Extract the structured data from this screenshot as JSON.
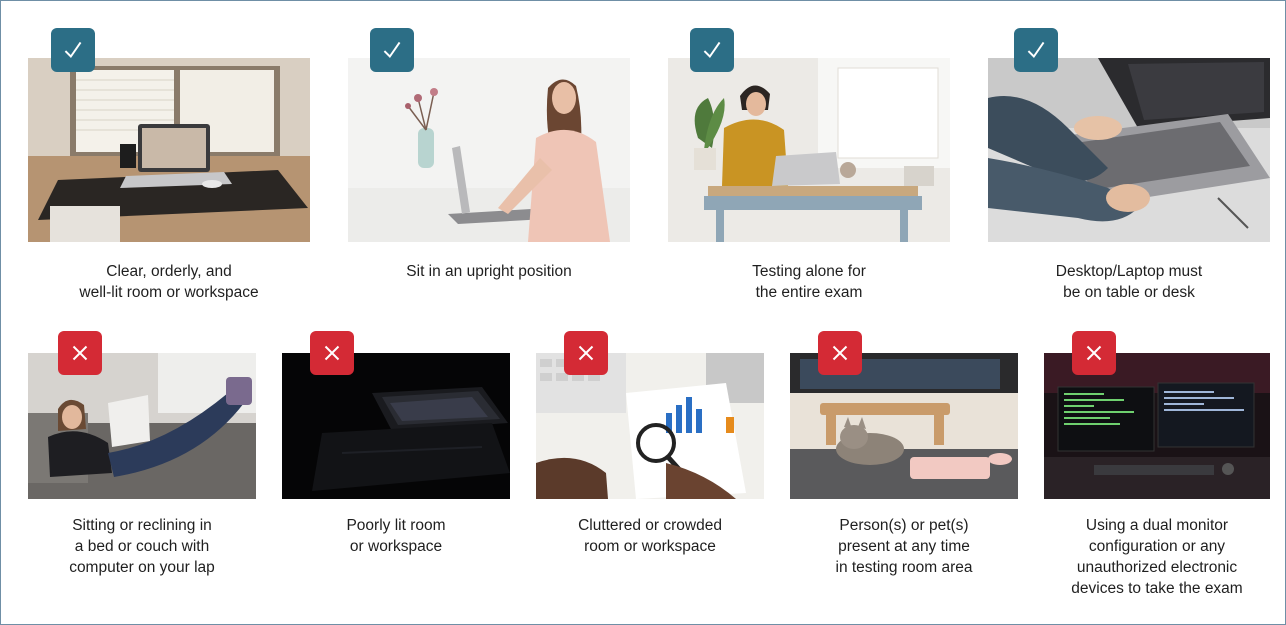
{
  "colors": {
    "frame_border": "#6f8fa6",
    "check_badge": "#2c6e86",
    "cross_badge": "#d42a35",
    "text": "#1f1f1f"
  },
  "dos": [
    {
      "icon": "checkmark-icon",
      "caption_lines": [
        "Clear, orderly, and",
        "well-lit room or workspace"
      ]
    },
    {
      "icon": "checkmark-icon",
      "caption_lines": [
        "Sit in an upright position"
      ]
    },
    {
      "icon": "checkmark-icon",
      "caption_lines": [
        "Testing alone for",
        "the entire exam"
      ]
    },
    {
      "icon": "checkmark-icon",
      "caption_lines": [
        "Desktop/Laptop must",
        "be on table or desk"
      ]
    }
  ],
  "donts": [
    {
      "icon": "cross-icon",
      "caption_lines": [
        "Sitting or reclining in",
        "a bed or couch with",
        "computer on your lap"
      ]
    },
    {
      "icon": "cross-icon",
      "caption_lines": [
        "Poorly lit room",
        "or workspace"
      ]
    },
    {
      "icon": "cross-icon",
      "caption_lines": [
        "Cluttered or crowded",
        "room or workspace"
      ]
    },
    {
      "icon": "cross-icon",
      "caption_lines": [
        "Person(s) or pet(s)",
        "present at any time",
        "in testing room area"
      ]
    },
    {
      "icon": "cross-icon",
      "caption_lines": [
        "Using a dual monitor",
        "configuration or any",
        "unauthorized electronic",
        "devices to take the exam"
      ]
    }
  ]
}
